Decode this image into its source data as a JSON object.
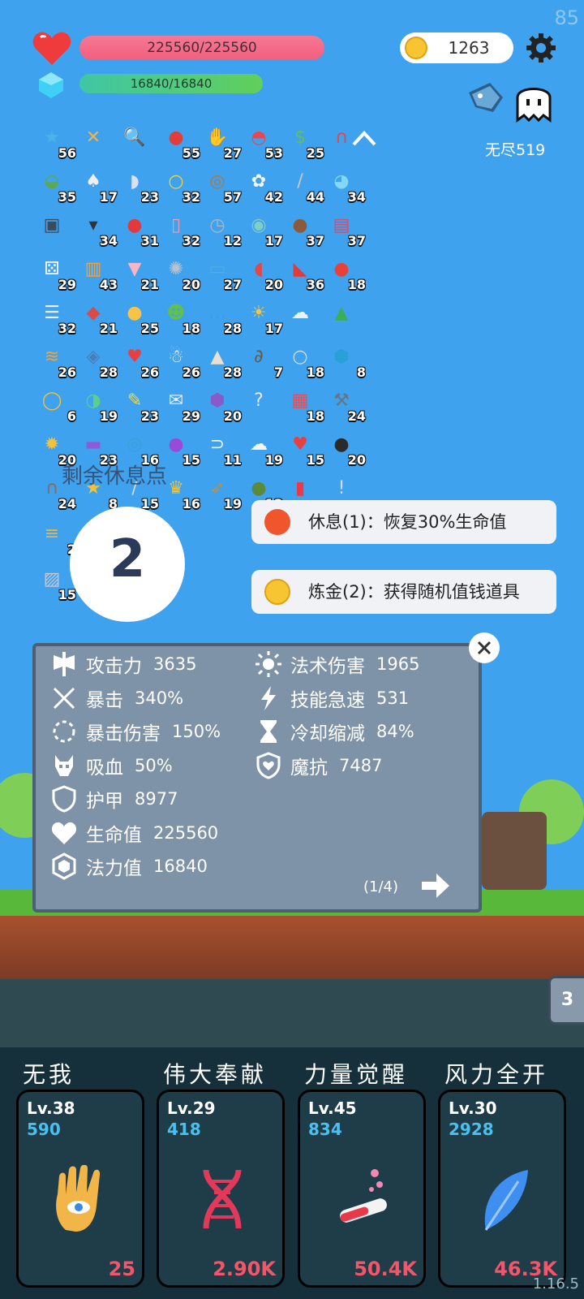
{
  "fps": "85",
  "version": "1.16.5",
  "hud": {
    "hp_text": "225560/225560",
    "mp_text": "16840/16840",
    "coins": "1263",
    "mode_label": "无尽519"
  },
  "items": [
    {
      "g": "★",
      "c": "#4cb3e8",
      "n": "56"
    },
    {
      "g": "✕",
      "c": "#f2b24a",
      "n": ""
    },
    {
      "g": "🔍",
      "c": "#3ea2ee",
      "n": ""
    },
    {
      "g": "●",
      "c": "#e33c3c",
      "n": "55"
    },
    {
      "g": "✋",
      "c": "#f3c27a",
      "n": "27"
    },
    {
      "g": "◓",
      "c": "#e8474f",
      "n": "53"
    },
    {
      "g": "$",
      "c": "#5fbf5f",
      "n": "25"
    },
    {
      "g": "∩",
      "c": "#e24848",
      "n": ""
    },
    {
      "g": "◒",
      "c": "#5aa85a",
      "n": "35"
    },
    {
      "g": "♠",
      "c": "#f0f0f0",
      "n": "17"
    },
    {
      "g": "◗",
      "c": "#d8e0f5",
      "n": "23"
    },
    {
      "g": "○",
      "c": "#f1d23a",
      "n": "32"
    },
    {
      "g": "◎",
      "c": "#b0763e",
      "n": "57"
    },
    {
      "g": "✿",
      "c": "#f5f5f5",
      "n": "42"
    },
    {
      "g": "/",
      "c": "#c9c9c9",
      "n": "44"
    },
    {
      "g": "◕",
      "c": "#82d8f5",
      "n": "34"
    },
    {
      "g": "▣",
      "c": "#3c4a5a",
      "n": ""
    },
    {
      "g": "▾",
      "c": "#333",
      "n": "34"
    },
    {
      "g": "●",
      "c": "#e2383e",
      "n": "31"
    },
    {
      "g": "▯",
      "c": "#f29ab5",
      "n": "32"
    },
    {
      "g": "◷",
      "c": "#aeb8c2",
      "n": "12"
    },
    {
      "g": "◉",
      "c": "#7ecfc4",
      "n": "17"
    },
    {
      "g": "●",
      "c": "#8a5a3a",
      "n": "37"
    },
    {
      "g": "▤",
      "c": "#d94a6b",
      "n": "37"
    },
    {
      "g": "⚄",
      "c": "#f5f5f5",
      "n": "29"
    },
    {
      "g": "▥",
      "c": "#f2a23a",
      "n": "43"
    },
    {
      "g": "▼",
      "c": "#f5b7c5",
      "n": "21"
    },
    {
      "g": "✺",
      "c": "#b9c3cf",
      "n": "20"
    },
    {
      "g": "▭",
      "c": "#4cb0e0",
      "n": "27"
    },
    {
      "g": "◖",
      "c": "#e54646",
      "n": "20"
    },
    {
      "g": "◣",
      "c": "#e33a3a",
      "n": "36"
    },
    {
      "g": "●",
      "c": "#e8413b",
      "n": "18"
    },
    {
      "g": "☰",
      "c": "#e9eef5",
      "n": "32"
    },
    {
      "g": "◆",
      "c": "#d94a4a",
      "n": "21"
    },
    {
      "g": "●",
      "c": "#f7c448",
      "n": "25"
    },
    {
      "g": "☻",
      "c": "#5fbf4f",
      "n": "18"
    },
    {
      "g": "…",
      "c": "#3aa0d8",
      "n": "28"
    },
    {
      "g": "☀",
      "c": "#f6c542",
      "n": "17"
    },
    {
      "g": "☁",
      "c": "#e8f3fb",
      "n": ""
    },
    {
      "g": "▲",
      "c": "#3cae58",
      "n": ""
    },
    {
      "g": "≋",
      "c": "#f2a23a",
      "n": "26"
    },
    {
      "g": "◈",
      "c": "#4b7bb8",
      "n": "28"
    },
    {
      "g": "♥",
      "c": "#e84040",
      "n": "26"
    },
    {
      "g": "☃",
      "c": "#fafafa",
      "n": "26"
    },
    {
      "g": "▲",
      "c": "#e8e0d0",
      "n": "28"
    },
    {
      "g": "∂",
      "c": "#6a5a3a",
      "n": "7"
    },
    {
      "g": "○",
      "c": "#d8dde4",
      "n": "18"
    },
    {
      "g": "⬢",
      "c": "#2aa0d8",
      "n": "8"
    },
    {
      "g": "◯",
      "c": "#f2c23a",
      "n": "6"
    },
    {
      "g": "◑",
      "c": "#5ad08a",
      "n": "19"
    },
    {
      "g": "✎",
      "c": "#f5d84a",
      "n": "23"
    },
    {
      "g": "✉",
      "c": "#e8eef5",
      "n": "29"
    },
    {
      "g": "⬢",
      "c": "#8a5ac8",
      "n": "20"
    },
    {
      "g": "?",
      "c": "#e8e8e8",
      "n": ""
    },
    {
      "g": "▦",
      "c": "#f54a4a",
      "n": "18"
    },
    {
      "g": "⚒",
      "c": "#6a7480",
      "n": "24"
    },
    {
      "g": "✹",
      "c": "#f2c23a",
      "n": "20"
    },
    {
      "g": "▬",
      "c": "#8e5ad8",
      "n": "23"
    },
    {
      "g": "◎",
      "c": "#3aa0d8",
      "n": "16"
    },
    {
      "g": "●",
      "c": "#9a4ad8",
      "n": "15"
    },
    {
      "g": "⊃",
      "c": "#f5f5f5",
      "n": "11"
    },
    {
      "g": "☁",
      "c": "#f5f5f5",
      "n": "19"
    },
    {
      "g": "♥",
      "c": "#e84040",
      "n": "15"
    },
    {
      "g": "●",
      "c": "#2a2a2a",
      "n": "20"
    },
    {
      "g": "∩",
      "c": "#8a6a5a",
      "n": "24"
    },
    {
      "g": "★",
      "c": "#f2c23a",
      "n": "8"
    },
    {
      "g": "/",
      "c": "#d8d8d8",
      "n": "15"
    },
    {
      "g": "♛",
      "c": "#f2c23a",
      "n": "16"
    },
    {
      "g": "➶",
      "c": "#c98a3a",
      "n": "19"
    },
    {
      "g": "●",
      "c": "#5a8a3a",
      "n": "12"
    },
    {
      "g": "▮",
      "c": "#e83a4a",
      "n": ""
    },
    {
      "g": "!",
      "c": "#d8d8e8",
      "n": ""
    },
    {
      "g": "≡",
      "c": "#f2b23a",
      "n": "2"
    },
    {
      "g": "◼",
      "c": "#f28a8a",
      "n": ""
    },
    {
      "g": "▨",
      "c": "#c8c8d8",
      "n": "15"
    },
    {
      "g": "✦",
      "c": "#2a4a7a",
      "n": ""
    }
  ],
  "rest": {
    "label": "剩余休息点",
    "count": "2"
  },
  "options": [
    {
      "label": "休息(1)：恢复30%生命值",
      "icon": "fire-icon",
      "color": "#f0562e"
    },
    {
      "label": "炼金(2)：获得随机值钱道具",
      "icon": "coin-icon",
      "color": "#f7c531"
    }
  ],
  "stats": {
    "left": [
      {
        "name": "攻击力",
        "value": "3635",
        "icon": "axe-icon"
      },
      {
        "name": "暴击",
        "value": "340%",
        "icon": "crit-icon"
      },
      {
        "name": "暴击伤害",
        "value": "150%",
        "icon": "crit-damage-icon"
      },
      {
        "name": "吸血",
        "value": "50%",
        "icon": "skull-icon"
      },
      {
        "name": "护甲",
        "value": "8977",
        "icon": "shield-icon"
      },
      {
        "name": "生命值",
        "value": "225560",
        "icon": "heart-icon"
      },
      {
        "name": "法力值",
        "value": "16840",
        "icon": "crystal-icon"
      }
    ],
    "right": [
      {
        "name": "法术伤害",
        "value": "1965",
        "icon": "sun-icon"
      },
      {
        "name": "技能急速",
        "value": "531",
        "icon": "lightning-icon"
      },
      {
        "name": "冷却缩减",
        "value": "84%",
        "icon": "hourglass-icon"
      },
      {
        "name": "魔抗",
        "value": "7487",
        "icon": "magic-shield-icon"
      }
    ],
    "page": "(1/4)"
  },
  "side_tab": "3",
  "skills": [
    {
      "title": "无我",
      "level": "Lv.38",
      "value": "590",
      "cost": "25",
      "icon": "hand-eye-icon"
    },
    {
      "title": "伟大奉献",
      "level": "Lv.29",
      "value": "418",
      "cost": "2.90K",
      "icon": "dna-icon"
    },
    {
      "title": "力量觉醒",
      "level": "Lv.45",
      "value": "834",
      "cost": "50.4K",
      "icon": "potion-tube-icon"
    },
    {
      "title": "风力全开",
      "level": "Lv.30",
      "value": "2928",
      "cost": "46.3K",
      "icon": "feather-icon"
    }
  ]
}
